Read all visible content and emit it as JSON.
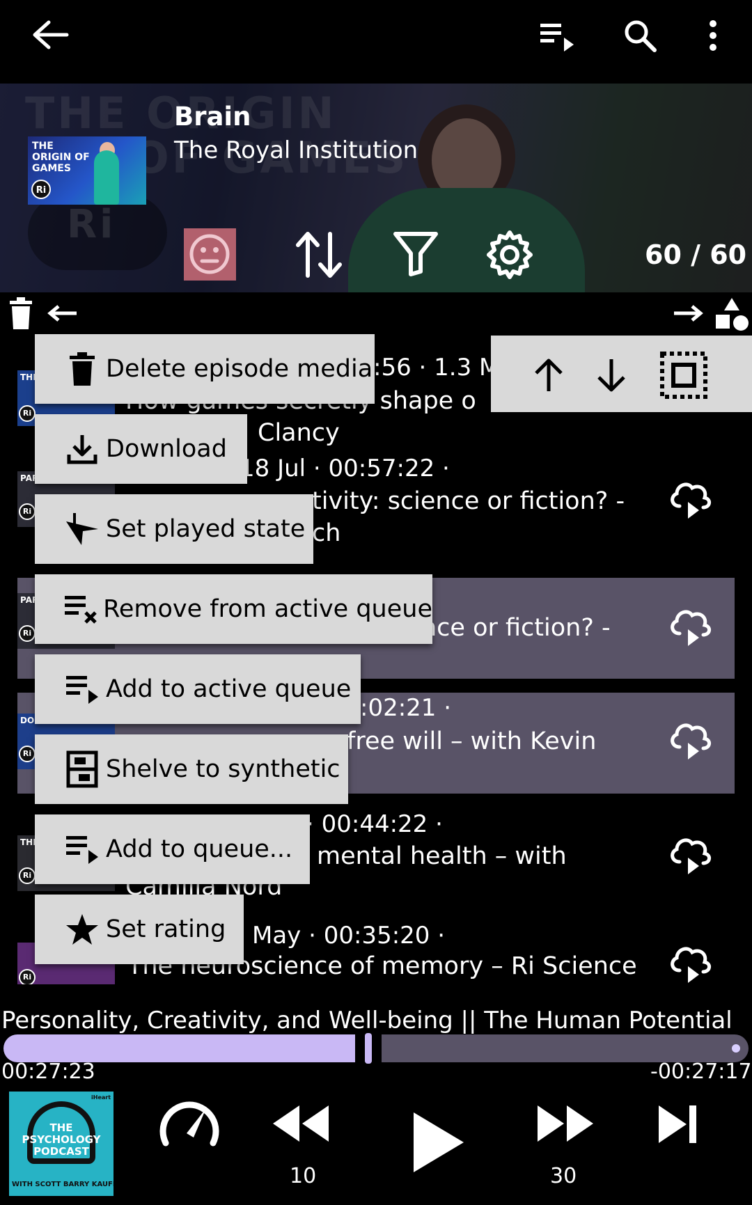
{
  "colors": {
    "background": "#000000",
    "selected_row": "#595367",
    "menu_bg": "#d9d9d9",
    "accent": "#c9b8f5",
    "mood_button": "#b2606d",
    "cover_bg": "#27b3c5"
  },
  "header": {
    "title": "Brain",
    "subtitle": "The Royal Institution",
    "banner_text_line1": "THE ORIGIN",
    "banner_text_line2": "OF GAMES",
    "banner_logo": "Ri",
    "thumb_label": "THE ORIGIN OF GAMES",
    "thumb_logo": "Ri",
    "counter": "60 / 60"
  },
  "toolbar_icons": [
    "back-arrow-icon",
    "queue-icon",
    "search-icon",
    "more-vert-icon",
    "emoji-neutral-icon",
    "sort-icon",
    "filter-icon",
    "settings-icon"
  ],
  "list": {
    "rows": [
      {
        "meta": ":56 · 1.3 M",
        "title": "How games secretly shape o",
        "title2": "Clancy",
        "thumb_label": "THE OF",
        "selected": false
      },
      {
        "meta": "18 Jul · 00:57:22 ·",
        "title": "tivity: science or fiction? -",
        "title2": "ch",
        "thumb_label": "PARANORMAL PSY",
        "selected": false
      },
      {
        "meta": "",
        "title": "nce or fiction? -",
        "title2": "",
        "thumb_label": "PAR PSY",
        "selected": true
      },
      {
        "meta": ":02:21 ·",
        "title": "free will – with Kevin",
        "title2": "",
        "thumb_label": "DO FREE WILL?",
        "selected": true
      },
      {
        "meta": "· 00:44:22 ·",
        "title": "mental health – with",
        "title2": "Camilla Nord",
        "thumb_label": "THE THE",
        "selected": false
      },
      {
        "meta": "May · 00:35:20 ·",
        "title": "The neuroscience of memory – Ri Science",
        "title2": "",
        "thumb_label": "",
        "selected": false
      }
    ],
    "row_logo": "Ri"
  },
  "menu": {
    "items": [
      {
        "label": "Delete episode media",
        "icon": "trash-icon"
      },
      {
        "label": "Download",
        "icon": "download-icon"
      },
      {
        "label": "Set played state",
        "icon": "played-state-icon"
      },
      {
        "label": "Remove from active queue",
        "icon": "queue-remove-icon"
      },
      {
        "label": "Add to active queue",
        "icon": "queue-add-icon"
      },
      {
        "label": "Shelve to synthetic",
        "icon": "shelve-icon"
      },
      {
        "label": "Add to queue...",
        "icon": "queue-add-icon"
      },
      {
        "label": "Set rating",
        "icon": "star-icon"
      }
    ]
  },
  "player": {
    "now_playing": "Personality, Creativity, and Well-being || The Human Potential",
    "elapsed": "00:27:23",
    "remaining": "-00:27:17",
    "progress_fraction": 0.5,
    "rewind_seconds": "10",
    "forward_seconds": "30",
    "cover_title": "THE PSYCHOLOGY PODCAST",
    "cover_byline": "WITH SCOTT BARRY KAUFMAN",
    "cover_brand": "iHeart"
  }
}
